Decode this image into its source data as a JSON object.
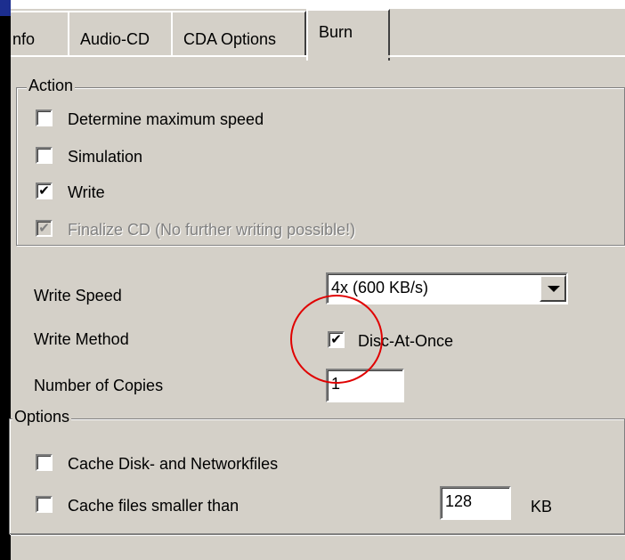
{
  "tabs": [
    {
      "label": "nfo",
      "active": false
    },
    {
      "label": "Audio-CD",
      "active": false
    },
    {
      "label": "CDA Options",
      "active": false
    },
    {
      "label": "Burn",
      "active": true
    }
  ],
  "action_group": {
    "title": "Action",
    "items": [
      {
        "label": "Determine maximum speed",
        "checked": false,
        "enabled": true
      },
      {
        "label": "Simulation",
        "checked": false,
        "enabled": true
      },
      {
        "label": "Write",
        "checked": true,
        "enabled": true
      },
      {
        "label": "Finalize CD (No further writing possible!)",
        "checked": true,
        "enabled": false
      }
    ]
  },
  "settings": {
    "write_speed_label": "Write Speed",
    "write_speed_value": "4x (600 KB/s)",
    "write_method_label": "Write Method",
    "write_method_option": "Disc-At-Once",
    "write_method_checked": true,
    "copies_label": "Number of Copies",
    "copies_value": "1"
  },
  "options_group": {
    "title": "Options",
    "cache_disk_label": "Cache Disk- and Networkfiles",
    "cache_disk_checked": false,
    "cache_small_label": "Cache files smaller than",
    "cache_small_checked": false,
    "cache_size_value": "128",
    "cache_size_unit": "KB"
  },
  "check_glyph": "✔",
  "annotation_color": "#e00000"
}
